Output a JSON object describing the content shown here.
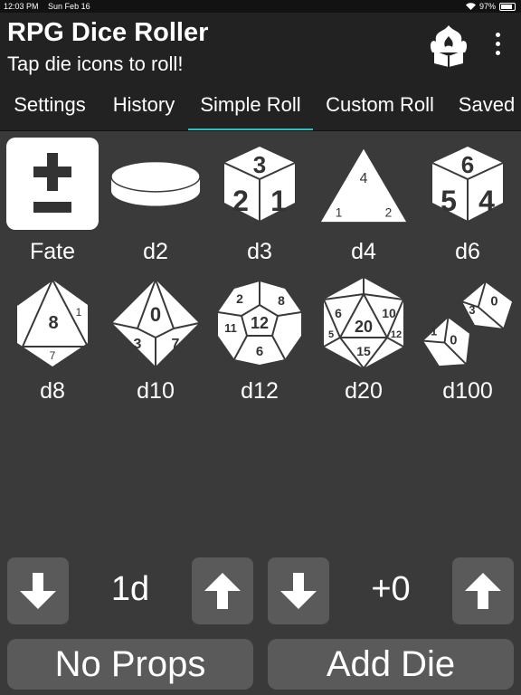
{
  "status_bar": {
    "time": "12:03 PM",
    "date": "Sun Feb 16",
    "battery": "97%",
    "icons": [
      "wifi-icon",
      "battery-icon"
    ]
  },
  "app_bar": {
    "title": "RPG Dice Roller",
    "subtitle": "Tap die icons to roll!",
    "logo_icon": "flaming-book-icon",
    "menu_icon": "more-vert-icon"
  },
  "tabs": [
    "Settings",
    "History",
    "Simple Roll",
    "Custom Roll",
    "Saved"
  ],
  "active_tab": "Simple Roll",
  "dice": [
    {
      "label": "Fate",
      "icon": "plus-minus-icon",
      "selected": true
    },
    {
      "label": "d2",
      "icon": "coin-icon"
    },
    {
      "label": "d3",
      "icon": "d3-die-icon",
      "faces": [
        "3",
        "2",
        "1"
      ]
    },
    {
      "label": "d4",
      "icon": "d4-die-icon",
      "faces": [
        "4",
        "1",
        "2"
      ]
    },
    {
      "label": "d6",
      "icon": "d6-die-icon",
      "faces": [
        "6",
        "5",
        "4"
      ]
    },
    {
      "label": "d8",
      "icon": "d8-die-icon",
      "faces": [
        "8",
        "1",
        "7"
      ]
    },
    {
      "label": "d10",
      "icon": "d10-die-icon",
      "faces": [
        "0",
        "3",
        "7"
      ]
    },
    {
      "label": "d12",
      "icon": "d12-die-icon",
      "faces": [
        "12",
        "2",
        "8",
        "11",
        "6"
      ]
    },
    {
      "label": "d20",
      "icon": "d20-die-icon",
      "faces": [
        "20",
        "6",
        "10",
        "15",
        "5",
        "12"
      ]
    },
    {
      "label": "d100",
      "icon": "d100-dice-icon",
      "faces": [
        "0",
        "3",
        "1",
        "0"
      ]
    }
  ],
  "controls": {
    "count_value": "1d",
    "modifier_value": "+0",
    "down_icon": "arrow-down-icon",
    "up_icon": "arrow-up-icon"
  },
  "buttons": {
    "props": "No Props",
    "add_die": "Add Die"
  },
  "colors": {
    "background": "#3a3a3a",
    "bar": "#222222",
    "accent": "#2bbfbf",
    "button": "#5a5a5a"
  }
}
